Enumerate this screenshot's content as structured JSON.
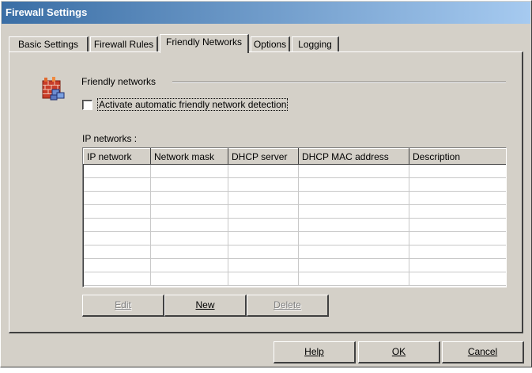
{
  "window": {
    "title": "Firewall Settings"
  },
  "tabs": [
    {
      "label": "Basic Settings",
      "active": false
    },
    {
      "label": "Firewall Rules",
      "active": false
    },
    {
      "label": "Friendly Networks",
      "active": true
    },
    {
      "label": "Options",
      "active": false
    },
    {
      "label": "Logging",
      "active": false
    }
  ],
  "panel": {
    "section_label": "Friendly networks",
    "auto_detect_checkbox": {
      "label": "Activate automatic friendly network detection",
      "checked": false
    },
    "ip_networks_label": "IP networks :",
    "grid": {
      "columns": [
        "IP network",
        "Network mask",
        "DHCP server",
        "DHCP MAC address",
        "Description"
      ],
      "rows": []
    },
    "buttons": {
      "edit": {
        "label": "Edit",
        "enabled": false
      },
      "new": {
        "label": "New",
        "enabled": true
      },
      "delete": {
        "label": "Delete",
        "enabled": false
      }
    }
  },
  "footer_buttons": {
    "help": "Help",
    "ok": "OK",
    "cancel": "Cancel"
  },
  "icon": "firewall-brick-network-icon",
  "colors": {
    "title_gradient_start": "#3a6ea5",
    "title_gradient_end": "#a6caf0",
    "face": "#d4d0c8"
  }
}
